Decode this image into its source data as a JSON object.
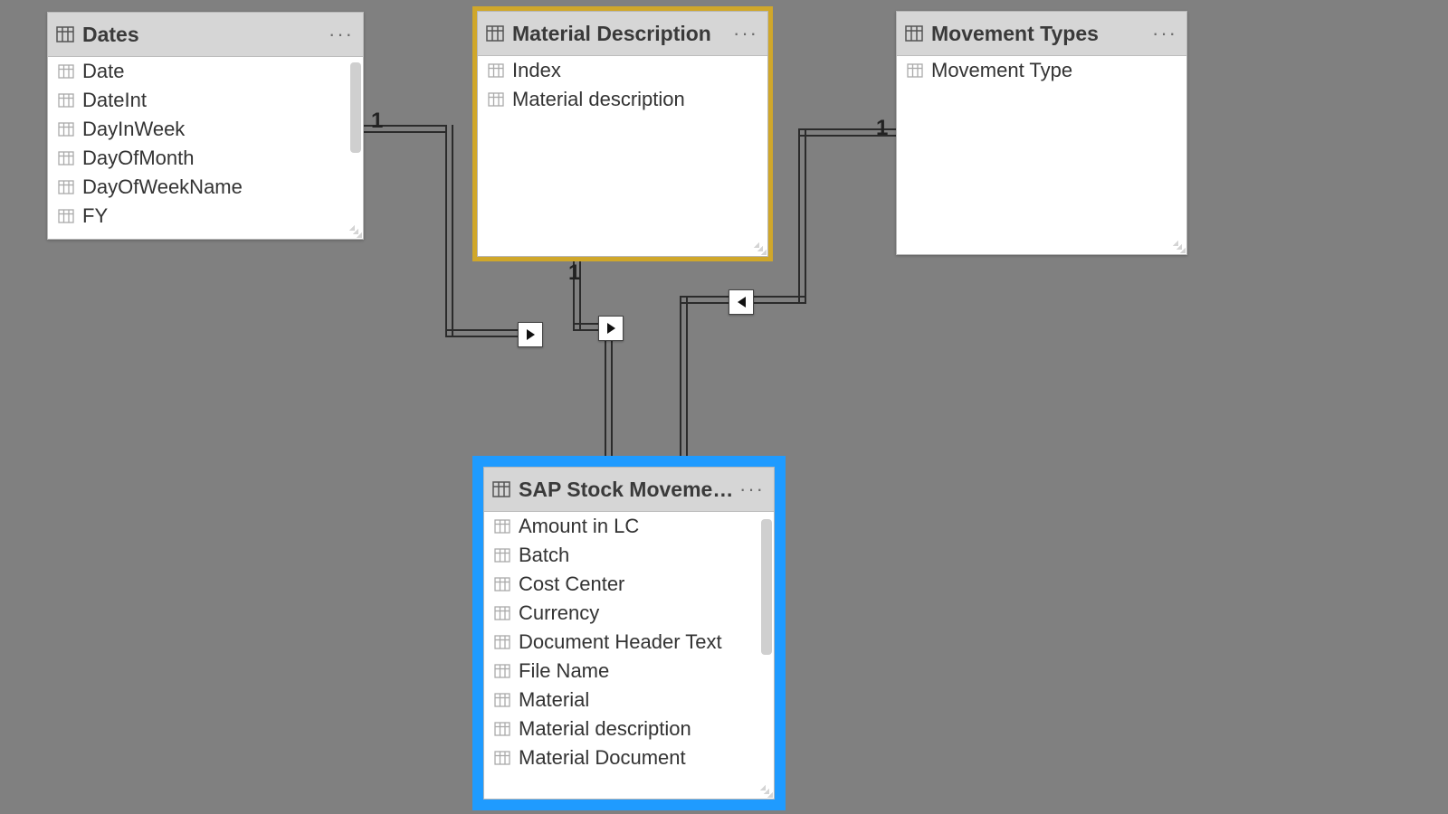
{
  "tables": {
    "dates": {
      "title": "Dates",
      "fields": [
        "Date",
        "DateInt",
        "DayInWeek",
        "DayOfMonth",
        "DayOfWeekName",
        "FY"
      ]
    },
    "material": {
      "title": "Material Description",
      "fields": [
        "Index",
        "Material description"
      ]
    },
    "movementTypes": {
      "title": "Movement Types",
      "fields": [
        "Movement Type"
      ]
    },
    "sap": {
      "title": "SAP Stock Movements",
      "fields": [
        "Amount in LC",
        "Batch",
        "Cost Center",
        "Currency",
        "Document Header Text",
        "File Name",
        "Material",
        "Material description",
        "Material Document"
      ]
    }
  },
  "relations": {
    "dates_to_sap": {
      "from_card": "1",
      "to_card": "*",
      "direction": "to-sap"
    },
    "material_to_sap": {
      "from_card": "1",
      "to_card": "*",
      "direction": "to-sap"
    },
    "movtype_to_sap": {
      "from_card": "1",
      "to_card": "*",
      "direction": "to-sap"
    }
  },
  "ui": {
    "more": "···"
  }
}
